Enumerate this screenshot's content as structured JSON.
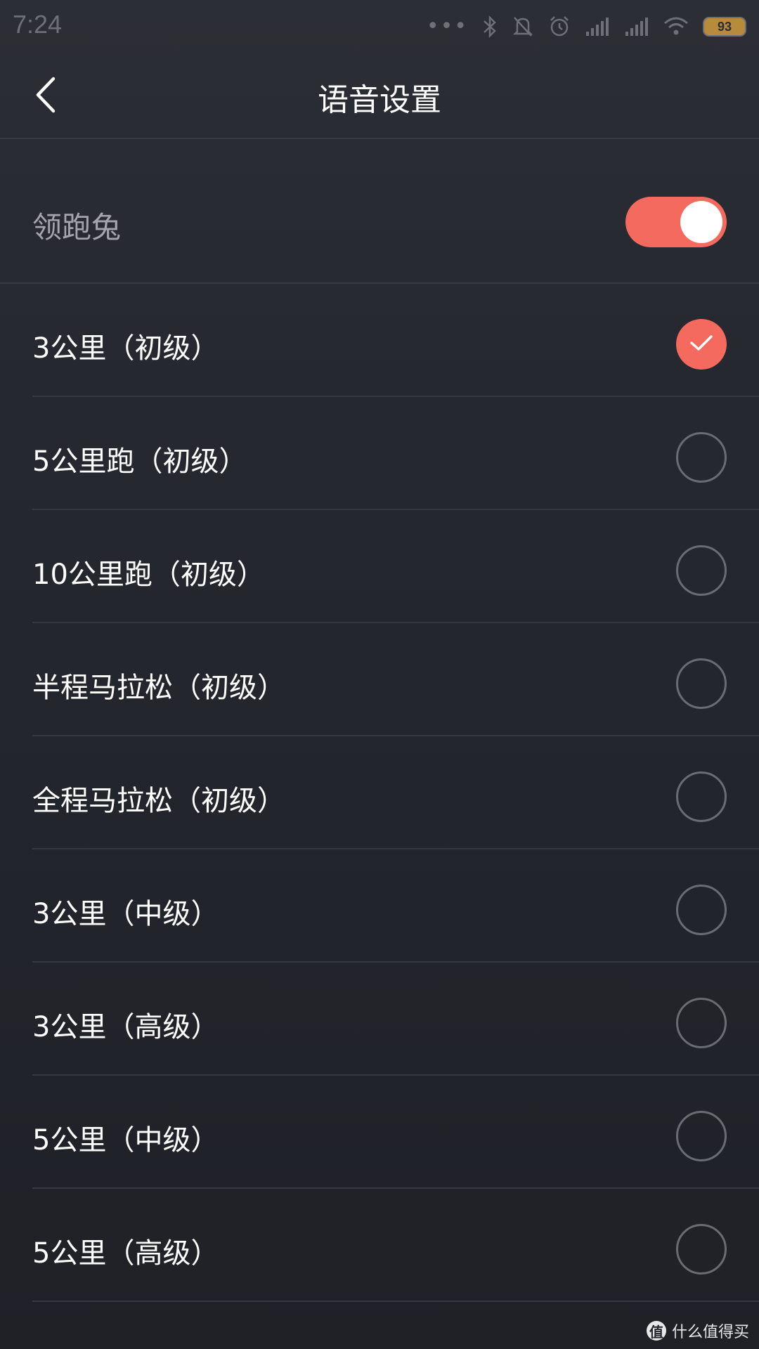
{
  "status_bar": {
    "time": "7:24",
    "dots": "•••",
    "battery": "93",
    "icons": [
      "bluetooth-icon",
      "mute-icon",
      "alarm-icon",
      "signal-icon",
      "signal-icon",
      "wifi-icon",
      "battery-icon"
    ]
  },
  "header": {
    "back_icon": "chevron-left-icon",
    "title": "语音设置"
  },
  "pacer": {
    "label": "领跑兔",
    "enabled": true,
    "accent_color": "#f56a5e"
  },
  "options": [
    {
      "label": "3公里（初级）",
      "selected": true
    },
    {
      "label": "5公里跑（初级）",
      "selected": false
    },
    {
      "label": "10公里跑（初级）",
      "selected": false
    },
    {
      "label": "半程马拉松（初级）",
      "selected": false
    },
    {
      "label": "全程马拉松（初级）",
      "selected": false
    },
    {
      "label": "3公里（中级）",
      "selected": false
    },
    {
      "label": "3公里（高级）",
      "selected": false
    },
    {
      "label": "5公里（中级）",
      "selected": false
    },
    {
      "label": "5公里（高级）",
      "selected": false
    }
  ],
  "watermark": {
    "logo": "值",
    "text": "什么值得买"
  }
}
